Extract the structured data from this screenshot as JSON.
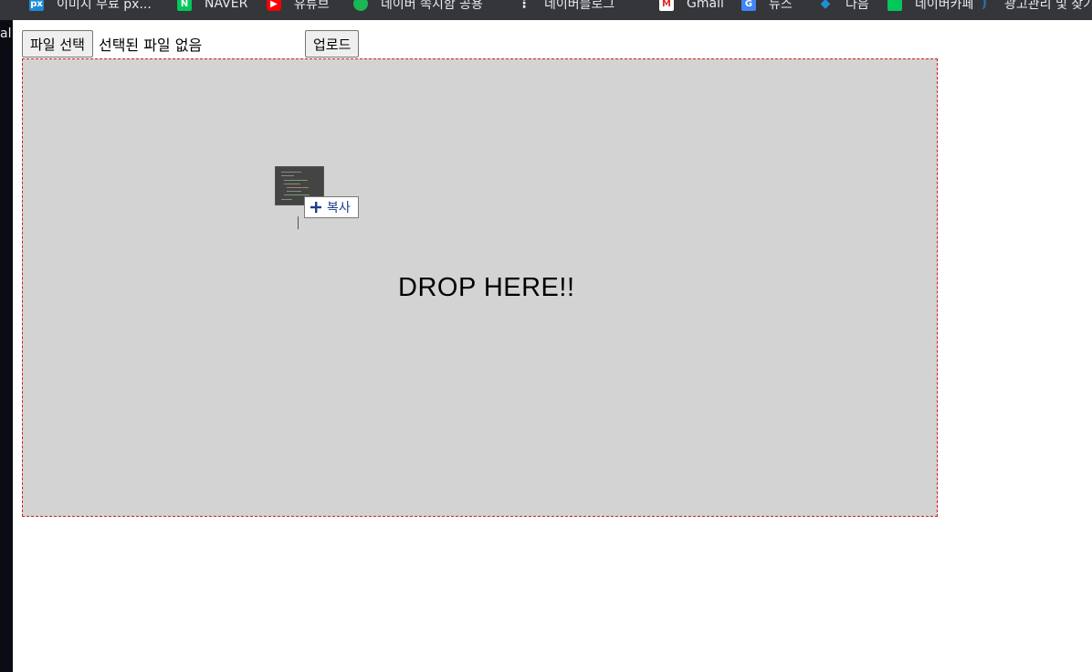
{
  "bookmarks": [
    {
      "label": "이미지 무료 px...",
      "icon": "pixabay-icon",
      "color": "#1b8bd9",
      "glyph": "px"
    },
    {
      "label": "NAVER",
      "icon": "naver-icon",
      "color": "#03c75a",
      "glyph": "N"
    },
    {
      "label": "유튜브",
      "icon": "youtube-icon",
      "color": "#ff0000",
      "glyph": "▶"
    },
    {
      "label": "네이버 쪽지함 공용",
      "icon": "chat-icon",
      "color": "#19b852",
      "glyph": "●"
    },
    {
      "label": "네이버블로그",
      "icon": "dots-icon",
      "color": "#35363a",
      "glyph": "⋮"
    },
    {
      "label": "Gmail",
      "icon": "gmail-icon",
      "color": "#ffffff",
      "glyph": "M"
    },
    {
      "label": "뉴스",
      "icon": "google-news-icon",
      "color": "#4285f4",
      "glyph": "G"
    },
    {
      "label": "다음",
      "icon": "leaf-icon",
      "color": "#1f8fd6",
      "glyph": "◆"
    },
    {
      "label": "네이버카페",
      "icon": "cafe-icon",
      "color": "#03c75a",
      "glyph": "●"
    },
    {
      "label": "광고관리 및 찾기",
      "icon": "swirl-icon",
      "color": "#2a6fb5",
      "glyph": ")"
    }
  ],
  "left_strip_text": "al",
  "file_input": {
    "choose_label": "파일 선택",
    "status_text": "선택된 파일 없음"
  },
  "upload_button_label": "업로드",
  "drop_zone": {
    "text": "DROP HERE!!"
  },
  "drag_feedback": {
    "copy_label": "복사"
  },
  "colors": {
    "drop_zone_bg": "#d3d3d3",
    "drop_zone_border": "#d21f1f",
    "copy_text": "#1a3d8f",
    "bookmarks_bg": "#35363a"
  }
}
